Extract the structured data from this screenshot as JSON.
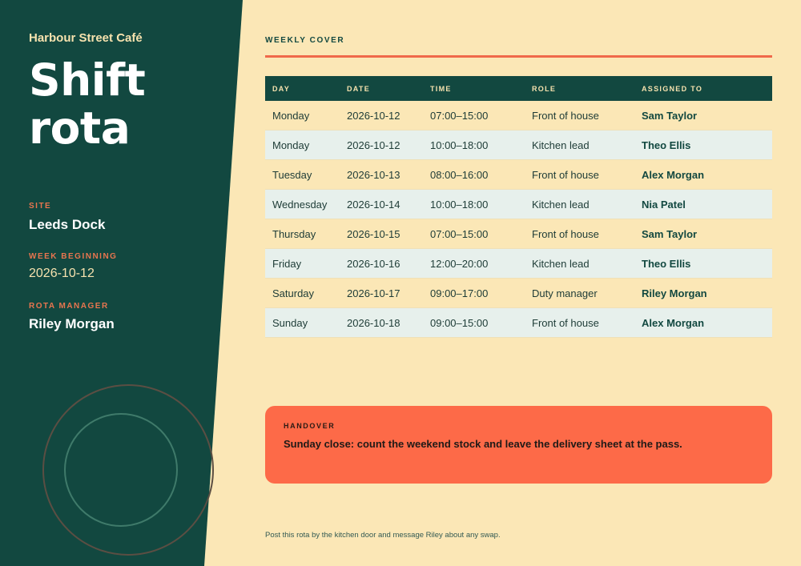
{
  "sidebar": {
    "cafe_name": "Harbour Street Café",
    "title": "Shift rota",
    "site_label": "SITE",
    "site": "Leeds Dock",
    "week_label": "WEEK BEGINNING",
    "week": "2026-10-12",
    "manager_label": "ROTA MANAGER",
    "manager": "Riley Morgan"
  },
  "cover": {
    "section_label": "WEEKLY COVER",
    "columns": [
      "DAY",
      "DATE",
      "TIME",
      "ROLE",
      "ASSIGNED TO"
    ],
    "rows": [
      {
        "day": "Monday",
        "date": "2026-10-12",
        "time": "07:00–15:00",
        "role": "Front of house",
        "assigned": "Sam Taylor"
      },
      {
        "day": "Monday",
        "date": "2026-10-12",
        "time": "10:00–18:00",
        "role": "Kitchen lead",
        "assigned": "Theo Ellis"
      },
      {
        "day": "Tuesday",
        "date": "2026-10-13",
        "time": "08:00–16:00",
        "role": "Front of house",
        "assigned": "Alex Morgan"
      },
      {
        "day": "Wednesday",
        "date": "2026-10-14",
        "time": "10:00–18:00",
        "role": "Kitchen lead",
        "assigned": "Nia Patel"
      },
      {
        "day": "Thursday",
        "date": "2026-10-15",
        "time": "07:00–15:00",
        "role": "Front of house",
        "assigned": "Sam Taylor"
      },
      {
        "day": "Friday",
        "date": "2026-10-16",
        "time": "12:00–20:00",
        "role": "Kitchen lead",
        "assigned": "Theo Ellis"
      },
      {
        "day": "Saturday",
        "date": "2026-10-17",
        "time": "09:00–17:00",
        "role": "Duty manager",
        "assigned": "Riley Morgan"
      },
      {
        "day": "Sunday",
        "date": "2026-10-18",
        "time": "09:00–15:00",
        "role": "Front of house",
        "assigned": "Alex Morgan"
      }
    ]
  },
  "handover": {
    "label": "HANDOVER",
    "text": "Sunday close: count the weekend stock and leave the delivery sheet at the pass."
  },
  "footer": {
    "note": "Post this rota by the kitchen door and message Riley about any swap."
  },
  "colors": {
    "sidebar": "#124840",
    "page": "#fbe7b6",
    "accent": "#fd6a48",
    "stripe": "#e7f0ec"
  }
}
